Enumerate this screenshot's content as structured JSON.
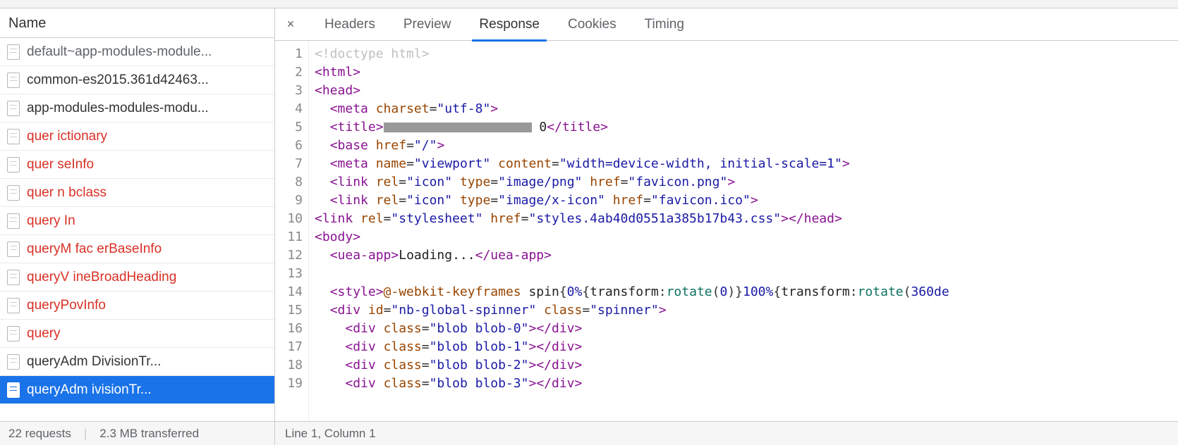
{
  "sidebar": {
    "header": "Name",
    "items": [
      {
        "label": "default~app-modules-module...",
        "type": "script",
        "clipped": true
      },
      {
        "label": "common-es2015.361d42463...",
        "type": "script"
      },
      {
        "label": "app-modules-modules-modu...",
        "type": "script"
      },
      {
        "label": "quer    ictionary",
        "type": "xhr"
      },
      {
        "label": "quer         seInfo",
        "type": "xhr"
      },
      {
        "label": "quer      n    bclass",
        "type": "xhr"
      },
      {
        "label": "query      In",
        "type": "xhr"
      },
      {
        "label": "queryM    fac   erBaseInfo",
        "type": "xhr"
      },
      {
        "label": "queryV    ineBroadHeading",
        "type": "xhr"
      },
      {
        "label": "queryPovInfo",
        "type": "xhr"
      },
      {
        "label": "query",
        "type": "xhr"
      },
      {
        "label": "queryAdm        DivisionTr...",
        "type": "script"
      },
      {
        "label": "queryAdm         ivisionTr...",
        "type": "script",
        "selected": true
      }
    ]
  },
  "tabs": {
    "items": [
      "Headers",
      "Preview",
      "Response",
      "Cookies",
      "Timing"
    ],
    "active": 2
  },
  "close_label": "×",
  "code": {
    "lines": [
      {
        "n": 1,
        "t": "doctype"
      },
      {
        "n": 2,
        "t": "open",
        "tag": "html"
      },
      {
        "n": 3,
        "t": "open",
        "tag": "head"
      },
      {
        "n": 4,
        "t": "meta_charset"
      },
      {
        "n": 5,
        "t": "title"
      },
      {
        "n": 6,
        "t": "base"
      },
      {
        "n": 7,
        "t": "meta_viewport"
      },
      {
        "n": 8,
        "t": "link_png"
      },
      {
        "n": 9,
        "t": "link_ico"
      },
      {
        "n": 10,
        "t": "link_css"
      },
      {
        "n": 11,
        "t": "open",
        "tag": "body"
      },
      {
        "n": 12,
        "t": "uea"
      },
      {
        "n": 13,
        "t": "blank"
      },
      {
        "n": 14,
        "t": "style_spin"
      },
      {
        "n": 15,
        "t": "div_spinner"
      },
      {
        "n": 16,
        "t": "blob",
        "i": 0
      },
      {
        "n": 17,
        "t": "blob",
        "i": 1
      },
      {
        "n": 18,
        "t": "blob",
        "i": 2
      },
      {
        "n": 19,
        "t": "blob",
        "i": 3
      }
    ],
    "strings": {
      "charset": "utf-8",
      "title_tail": "0",
      "base_href": "/",
      "viewport_name": "viewport",
      "viewport_content": "width=device-width, initial-scale=1",
      "icon_rel": "icon",
      "png_type": "image/png",
      "png_href": "favicon.png",
      "ico_type": "image/x-icon",
      "ico_href": "favicon.ico",
      "css_rel": "stylesheet",
      "css_href": "styles.4ab40d0551a385b17b43.css",
      "uea_text": "Loading...",
      "spinner_id": "nb-global-spinner",
      "spinner_class": "spinner",
      "blob_prefix": "blob blob-"
    }
  },
  "footer": {
    "requests": "22 requests",
    "transferred": "2.3 MB transferred",
    "cursor": "Line 1, Column 1"
  }
}
